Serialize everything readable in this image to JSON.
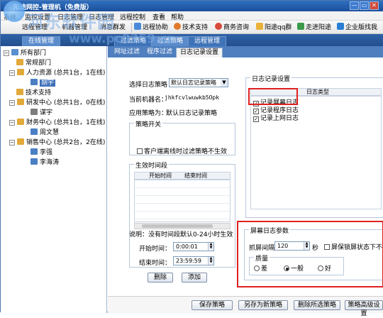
{
  "window": {
    "title": "阳途网控-管理机（免费版）",
    "min": "—",
    "max": "▭",
    "close": "✕"
  },
  "watermark": {
    "text": "河东软件园",
    "url": "www.pc0359.cn"
  },
  "menu": [
    "系统",
    "监控设置",
    "日志管理",
    "日志管理",
    "远程控制",
    "查看",
    "帮助"
  ],
  "toolbar": [
    "远程管理",
    "机器管理",
    "消息群发",
    "远程协助",
    "技术支持",
    "商务咨询",
    "阳途qq群",
    "走进阳途",
    "企业版找我"
  ],
  "subtabs": [
    "在线管理",
    "过滤策略",
    "过滤策略",
    "远程管理"
  ],
  "tree": {
    "root": "所有部门",
    "items": [
      {
        "label": "常规部门"
      },
      {
        "label": "人力资源 (总共1台，1在线)"
      },
      {
        "label": "胡宇",
        "selected": true
      },
      {
        "label": "技术支持"
      },
      {
        "label": "研发中心 (总共1台，0在线)"
      },
      {
        "label": "谋宇"
      },
      {
        "label": "财务中心 (总共1台，1在线)"
      },
      {
        "label": "周文慧"
      },
      {
        "label": "销售中心 (总共2台，2在线)"
      },
      {
        "label": "李强"
      },
      {
        "label": "李海涛"
      }
    ]
  },
  "inner_tabs": [
    "网址过滤",
    "程序过滤",
    "日志记录设置"
  ],
  "policy": {
    "select_label": "选择日志策略",
    "select_value": "默认日志记录策略",
    "machine_label": "当前机器名：",
    "machine_value": "jhkfcvlwuwkb5Opk",
    "apply_label": "应用策略为：",
    "apply_value": "默认日志记录策略",
    "switch_title": "策略开关",
    "switch_checkbox": "客户端离线时过滤策略不生效",
    "time_title": "生效时间段",
    "col_start": "开始时间",
    "col_end": "结束时间",
    "note": "说明：没有时间段默认0-24小时生效",
    "start_label": "开始时间：",
    "start_value": "0:00:01",
    "end_label": "结束时间：",
    "end_value": "23:59:59",
    "delete_btn": "删除",
    "add_btn": "添加"
  },
  "log_settings": {
    "title": "日志记录设置",
    "col_type": "日志类型",
    "items": [
      "记录屏幕日志",
      "记录程序日志",
      "记录上网日志"
    ]
  },
  "screen_log": {
    "title": "屏幕日志参数",
    "interval_label": "抓屏间隔",
    "interval_value": "120",
    "interval_unit": "秒",
    "screensaver_label": "屏保锁屏状态下不记",
    "quality_title": "质量",
    "quality_options": [
      "差",
      "一般",
      "好"
    ],
    "quality_selected": "一般"
  },
  "buttons": [
    "保存策略",
    "另存为新策略",
    "删除所选策略",
    "策略高级设置"
  ]
}
